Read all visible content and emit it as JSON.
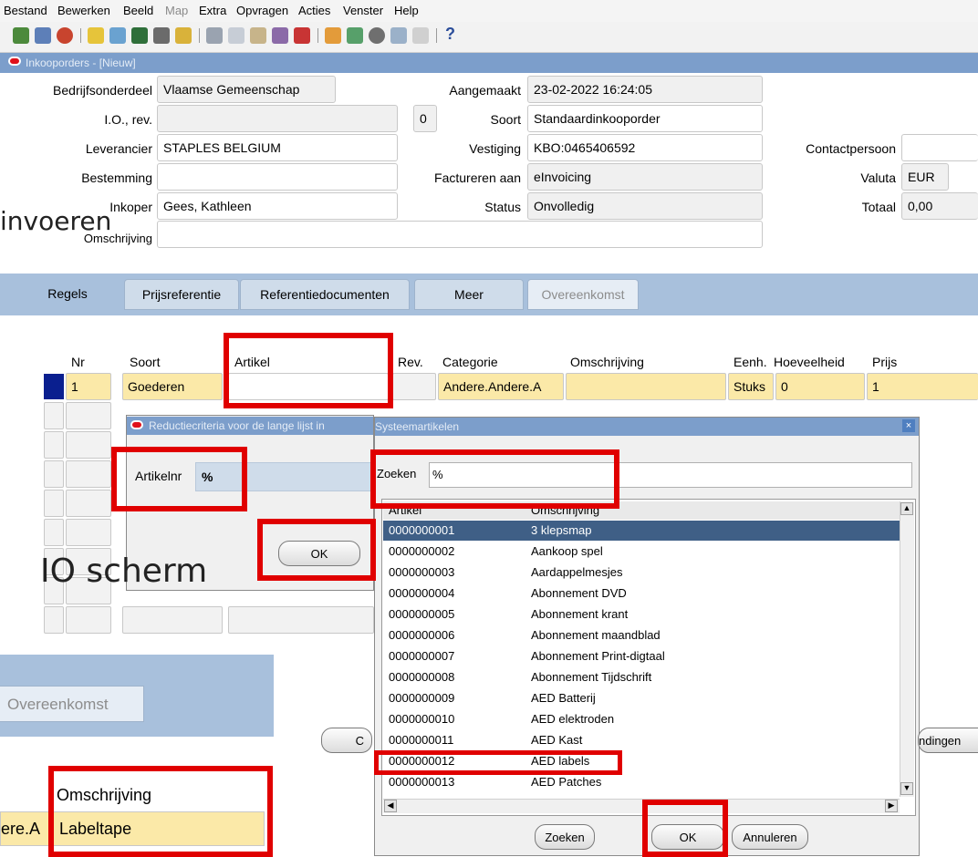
{
  "menu": [
    "Bestand",
    "Bewerken",
    "Beeld",
    "Map",
    "Extra",
    "Opvragen",
    "Acties",
    "Venster",
    "Help"
  ],
  "window_title": "Inkooporders - [Nieuw]",
  "header": {
    "bedrijfsonderdeel_label": "Bedrijfsonderdeel",
    "bedrijfsonderdeel_value": "Vlaamse Gemeenschap",
    "io_label": "I.O., rev.",
    "io_value": "",
    "rev_value": "0",
    "leverancier_label": "Leverancier",
    "leverancier_value": "STAPLES BELGIUM",
    "bestemming_label": "Bestemming",
    "bestemming_value": "",
    "inkoper_label": "Inkoper",
    "inkoper_value": "Gees, Kathleen",
    "omschrijving_label": "Omschrijving",
    "omschrijving_value": "",
    "aangemaakt_label": "Aangemaakt",
    "aangemaakt_value": "23-02-2022 16:24:05",
    "soort_label": "Soort",
    "soort_value": "Standaardinkooporder",
    "vestiging_label": "Vestiging",
    "vestiging_value": "KBO:0465406592",
    "factureren_label": "Factureren aan",
    "factureren_value": "eInvoicing",
    "status_label": "Status",
    "status_value": "Onvolledig",
    "contactpersoon_label": "Contactpersoon",
    "contactpersoon_value": "",
    "valuta_label": "Valuta",
    "valuta_value": "EUR",
    "totaal_label": "Totaal",
    "totaal_value": "0,00"
  },
  "overlay_text_1": "invoeren",
  "overlay_text_2": "IO scherm",
  "tabs": [
    "Regels",
    "Prijsreferentie",
    "Referentiedocumenten",
    "Meer",
    "Overeenkomst"
  ],
  "grid": {
    "columns": [
      "Nr",
      "Soort",
      "Artikel",
      "Rev.",
      "Categorie",
      "Omschrijving",
      "Eenh.",
      "Hoeveelheid",
      "Prijs"
    ],
    "row1": {
      "nr": "1",
      "soort": "Goederen",
      "artikel": "",
      "rev": "",
      "categorie": "Andere.Andere.A",
      "omschrijving": "",
      "eenh": "Stuks",
      "hoeveelheid": "0",
      "prijs": "1"
    }
  },
  "reduction_dialog": {
    "title": "Reductiecriteria voor de lange lijst in",
    "field_label": "Artikelnr",
    "field_value": "%",
    "ok_label": "OK"
  },
  "lov_dialog": {
    "title": "Systeemartikelen",
    "search_label": "Zoeken",
    "search_value": "%",
    "col_artikel": "Artikel",
    "col_omschrijving": "Omschrijving",
    "rows": [
      [
        "0000000001",
        "3 klepsmap"
      ],
      [
        "0000000002",
        "Aankoop spel"
      ],
      [
        "0000000003",
        "Aardappelmesjes"
      ],
      [
        "0000000004",
        "Abonnement DVD"
      ],
      [
        "0000000005",
        "Abonnement krant"
      ],
      [
        "0000000006",
        "Abonnement maandblad"
      ],
      [
        "0000000007",
        "Abonnement Print-digtaal"
      ],
      [
        "0000000008",
        "Abonnement Tijdschrift"
      ],
      [
        "0000000009",
        "AED Batterij"
      ],
      [
        "0000000010",
        "AED elektroden"
      ],
      [
        "0000000011",
        "AED Kast"
      ],
      [
        "0000000012",
        "AED labels"
      ],
      [
        "0000000013",
        "AED Patches"
      ]
    ],
    "find_button": "Zoeken",
    "ok_button": "OK",
    "cancel_button": "Annuleren"
  },
  "lower_inset": {
    "tab_label": "Overeenkomst",
    "col_header": "Omschrijving",
    "cell_left": "ere.A",
    "cell_value": "Labeltape"
  },
  "partial_buttons": {
    "left": "C",
    "right": "ndingen"
  },
  "colors": {
    "title_blue": "#7c9ecb",
    "tab_band": "#a8c0dc",
    "highlight_yellow": "#fbe9a8",
    "selection": "#3f5f86",
    "annotation_red": "#e00000"
  }
}
